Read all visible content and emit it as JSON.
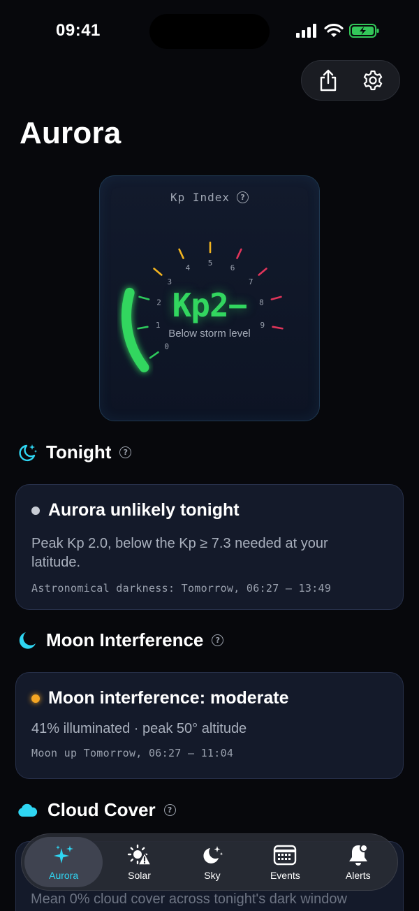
{
  "status_bar": {
    "time": "09:41"
  },
  "header": {
    "title": "Aurora"
  },
  "kp_card": {
    "label": "Kp Index",
    "value": "Kp2−",
    "kp_number": 2.0,
    "description": "Below storm level",
    "scale": [
      "0",
      "1",
      "2",
      "3",
      "4",
      "5",
      "6",
      "7",
      "8",
      "9"
    ],
    "colors": {
      "low": "#2ec95c",
      "mid": "#f2b420",
      "high": "#e0355a"
    }
  },
  "sections": {
    "tonight": {
      "title": "Tonight",
      "status": "Aurora unlikely tonight",
      "body": "Peak Kp 2.0, below the Kp ≥ 7.3 needed at your latitude.",
      "meta": "Astronomical darkness: Tomorrow, 06:27 — 13:49",
      "dot_color": "#c8ccd4"
    },
    "moon": {
      "title": "Moon Interference",
      "status": "Moon interference: moderate",
      "body": "41% illuminated · peak 50° altitude",
      "meta": "Moon up Tomorrow, 06:27 — 11:04",
      "dot_color": "#f5a623"
    },
    "cloud": {
      "title": "Cloud Cover",
      "body": "Mean 0% cloud cover across tonight's dark window"
    }
  },
  "tabs": [
    {
      "label": "Aurora",
      "icon": "sparkles-icon",
      "active": true
    },
    {
      "label": "Solar",
      "icon": "sun-warning-icon",
      "active": false
    },
    {
      "label": "Sky",
      "icon": "moon-stars-icon",
      "active": false
    },
    {
      "label": "Events",
      "icon": "calendar-icon",
      "active": false
    },
    {
      "label": "Alerts",
      "icon": "bell-icon",
      "active": false
    }
  ],
  "colors": {
    "accent": "#2fd6f3",
    "kp_green": "#32d65f",
    "background": "#07080c",
    "card": "#141a2a"
  }
}
